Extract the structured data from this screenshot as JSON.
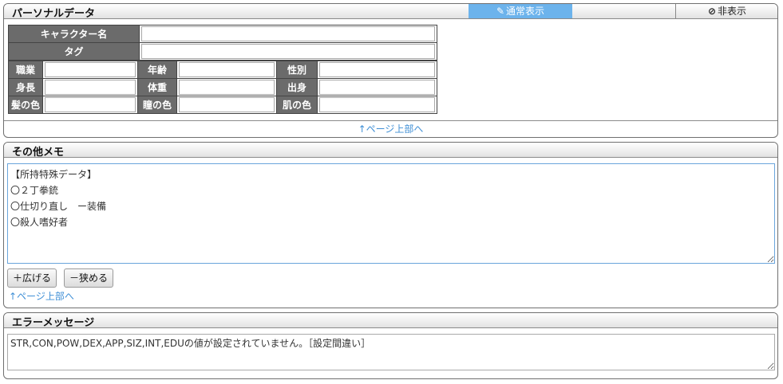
{
  "personal": {
    "title": "パーソナルデータ",
    "mode_normal": "通常表示",
    "mode_hide": "非表示",
    "rows": {
      "char_name": "キャラクター名",
      "tag": "タグ",
      "occupation": "職業",
      "age": "年齢",
      "sex": "性別",
      "height": "身長",
      "weight": "体重",
      "origin": "出身",
      "hair": "髪の色",
      "eyes": "瞳の色",
      "skin": "肌の色"
    },
    "top_link": "↑ページ上部へ"
  },
  "memo": {
    "title": "その他メモ",
    "text": "【所持特殊データ】\n〇２丁拳銃\n〇仕切り直し　ー装備\n〇殺人嗜好者",
    "expand_button": "＋広げる",
    "shrink_button": "－狭める",
    "top_link": "↑ページ上部へ"
  },
  "errors": {
    "title": "エラーメッセージ",
    "text": "STR,CON,POW,DEX,APP,SIZ,INT,EDUの値が設定されていません。［設定間違い］"
  },
  "colors": {
    "label_bg": "#6b6b6b",
    "accent": "#6cb3ec",
    "link": "#3f8fd6"
  },
  "icons": [
    "pencil-icon",
    "no-entry-icon"
  ]
}
